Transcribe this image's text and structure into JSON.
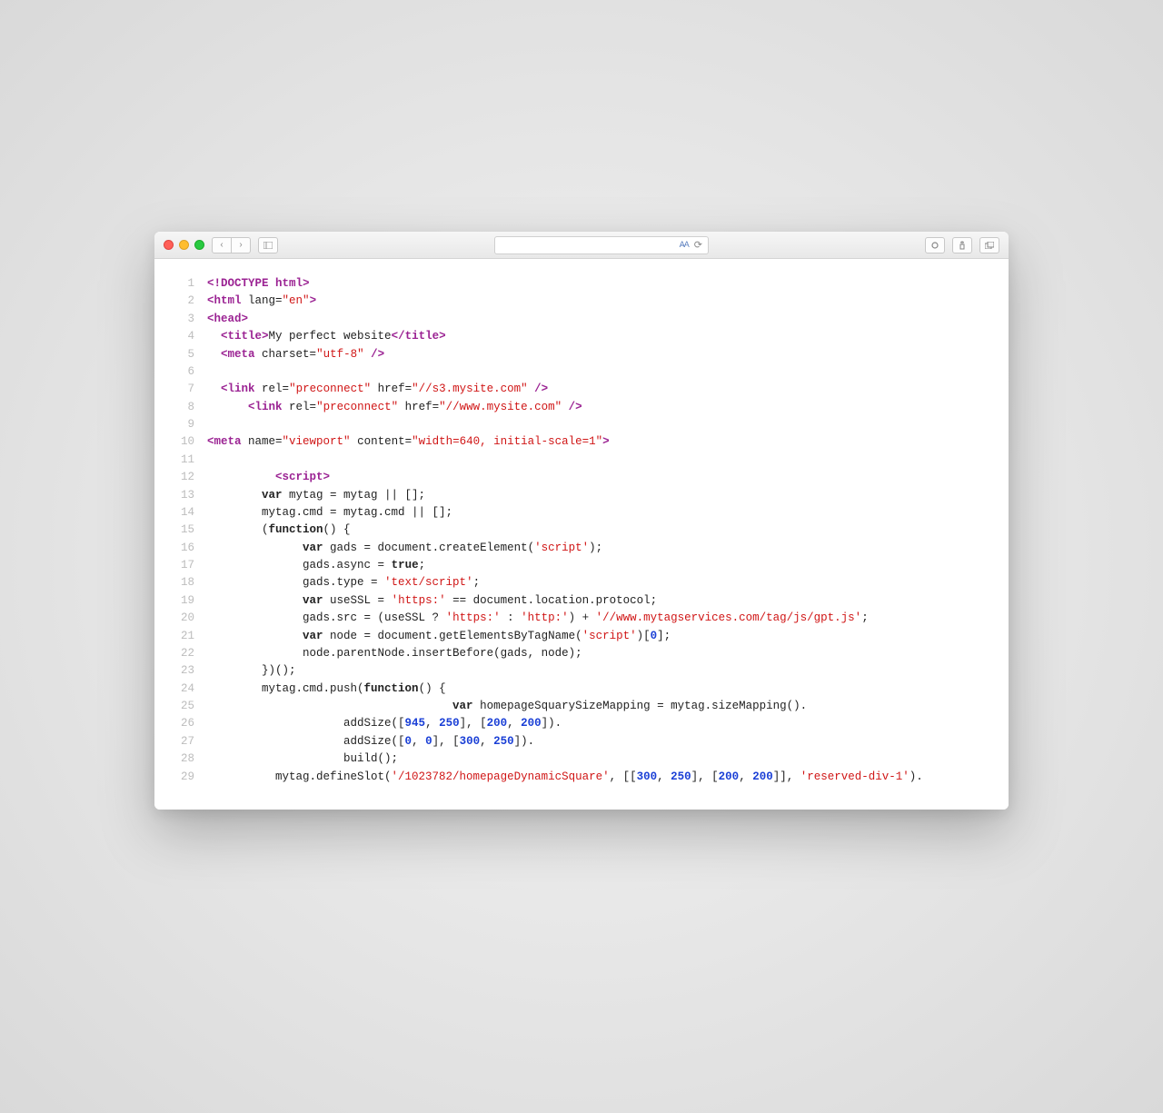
{
  "toolbar": {
    "addr_hint": "⟳",
    "reader_icon": "≡"
  },
  "code_lines": [
    {
      "n": 1,
      "indent": 0,
      "tokens": [
        [
          "tag",
          "<!DOCTYPE html>"
        ]
      ]
    },
    {
      "n": 2,
      "indent": 0,
      "tokens": [
        [
          "tag",
          "<html"
        ],
        [
          "plain",
          " "
        ],
        [
          "attr-name",
          "lang="
        ],
        [
          "str",
          "\"en\""
        ],
        [
          "tag",
          ">"
        ]
      ]
    },
    {
      "n": 3,
      "indent": 0,
      "tokens": [
        [
          "tag",
          "<head>"
        ]
      ]
    },
    {
      "n": 4,
      "indent": 2,
      "tokens": [
        [
          "tag",
          "<title>"
        ],
        [
          "plain",
          "My perfect website"
        ],
        [
          "tag",
          "</title>"
        ]
      ]
    },
    {
      "n": 5,
      "indent": 2,
      "tokens": [
        [
          "tag",
          "<meta"
        ],
        [
          "plain",
          " "
        ],
        [
          "attr-name",
          "charset="
        ],
        [
          "str",
          "\"utf-8\""
        ],
        [
          "plain",
          " "
        ],
        [
          "tag",
          "/>"
        ]
      ]
    },
    {
      "n": 6,
      "indent": 0,
      "tokens": []
    },
    {
      "n": 7,
      "indent": 2,
      "tokens": [
        [
          "tag",
          "<link"
        ],
        [
          "plain",
          " "
        ],
        [
          "attr-name",
          "rel="
        ],
        [
          "str",
          "\"preconnect\""
        ],
        [
          "plain",
          " "
        ],
        [
          "attr-name",
          "href="
        ],
        [
          "str",
          "\"//s3.mysite.com\""
        ],
        [
          "plain",
          " "
        ],
        [
          "tag",
          "/>"
        ]
      ]
    },
    {
      "n": 8,
      "indent": 6,
      "tokens": [
        [
          "tag",
          "<link"
        ],
        [
          "plain",
          " "
        ],
        [
          "attr-name",
          "rel="
        ],
        [
          "str",
          "\"preconnect\""
        ],
        [
          "plain",
          " "
        ],
        [
          "attr-name",
          "href="
        ],
        [
          "str",
          "\"//www.mysite.com\""
        ],
        [
          "plain",
          " "
        ],
        [
          "tag",
          "/>"
        ]
      ]
    },
    {
      "n": 9,
      "indent": 0,
      "tokens": []
    },
    {
      "n": 10,
      "indent": 0,
      "tokens": [
        [
          "tag",
          "<meta"
        ],
        [
          "plain",
          " "
        ],
        [
          "attr-name",
          "name="
        ],
        [
          "str",
          "\"viewport\""
        ],
        [
          "plain",
          " "
        ],
        [
          "attr-name",
          "content="
        ],
        [
          "str",
          "\"width=640, initial-scale=1\""
        ],
        [
          "tag",
          ">"
        ]
      ]
    },
    {
      "n": 11,
      "indent": 0,
      "tokens": []
    },
    {
      "n": 12,
      "indent": 10,
      "tokens": [
        [
          "tag",
          "<script>"
        ]
      ]
    },
    {
      "n": 13,
      "indent": 8,
      "tokens": [
        [
          "kw",
          "var"
        ],
        [
          "plain",
          " mytag = mytag || [];"
        ]
      ]
    },
    {
      "n": 14,
      "indent": 8,
      "tokens": [
        [
          "plain",
          "mytag.cmd = mytag.cmd || [];"
        ]
      ]
    },
    {
      "n": 15,
      "indent": 8,
      "tokens": [
        [
          "plain",
          "("
        ],
        [
          "kw",
          "function"
        ],
        [
          "plain",
          "() {"
        ]
      ]
    },
    {
      "n": 16,
      "indent": 14,
      "tokens": [
        [
          "kw",
          "var"
        ],
        [
          "plain",
          " gads = document.createElement("
        ],
        [
          "str",
          "'script'"
        ],
        [
          "plain",
          ");"
        ]
      ]
    },
    {
      "n": 17,
      "indent": 14,
      "tokens": [
        [
          "plain",
          "gads.async = "
        ],
        [
          "kw",
          "true"
        ],
        [
          "plain",
          ";"
        ]
      ]
    },
    {
      "n": 18,
      "indent": 14,
      "tokens": [
        [
          "plain",
          "gads.type = "
        ],
        [
          "str",
          "'text/script'"
        ],
        [
          "plain",
          ";"
        ]
      ]
    },
    {
      "n": 19,
      "indent": 14,
      "tokens": [
        [
          "kw",
          "var"
        ],
        [
          "plain",
          " useSSL = "
        ],
        [
          "str",
          "'https:'"
        ],
        [
          "plain",
          " == document.location.protocol;"
        ]
      ]
    },
    {
      "n": 20,
      "indent": 14,
      "tokens": [
        [
          "plain",
          "gads.src = (useSSL ? "
        ],
        [
          "str",
          "'https:'"
        ],
        [
          "plain",
          " : "
        ],
        [
          "str",
          "'http:'"
        ],
        [
          "plain",
          ") + "
        ],
        [
          "str",
          "'//www.mytagservices.com/tag/js/gpt.js'"
        ],
        [
          "plain",
          ";"
        ]
      ]
    },
    {
      "n": 21,
      "indent": 14,
      "tokens": [
        [
          "kw",
          "var"
        ],
        [
          "plain",
          " node = document.getElementsByTagName("
        ],
        [
          "str",
          "'script'"
        ],
        [
          "plain",
          ")["
        ],
        [
          "num",
          "0"
        ],
        [
          "plain",
          "];"
        ]
      ]
    },
    {
      "n": 22,
      "indent": 14,
      "tokens": [
        [
          "plain",
          "node.parentNode.insertBefore(gads, node);"
        ]
      ]
    },
    {
      "n": 23,
      "indent": 8,
      "tokens": [
        [
          "plain",
          "})();"
        ]
      ]
    },
    {
      "n": 24,
      "indent": 8,
      "tokens": [
        [
          "plain",
          "mytag.cmd.push("
        ],
        [
          "kw",
          "function"
        ],
        [
          "plain",
          "() {"
        ]
      ]
    },
    {
      "n": 25,
      "indent": 36,
      "tokens": [
        [
          "kw",
          "var"
        ],
        [
          "plain",
          " homepageSquarySizeMapping = mytag.sizeMapping()."
        ]
      ]
    },
    {
      "n": 26,
      "indent": 20,
      "tokens": [
        [
          "plain",
          "addSize(["
        ],
        [
          "num",
          "945"
        ],
        [
          "plain",
          ", "
        ],
        [
          "num",
          "250"
        ],
        [
          "plain",
          "], ["
        ],
        [
          "num",
          "200"
        ],
        [
          "plain",
          ", "
        ],
        [
          "num",
          "200"
        ],
        [
          "plain",
          "])."
        ]
      ]
    },
    {
      "n": 27,
      "indent": 20,
      "tokens": [
        [
          "plain",
          "addSize(["
        ],
        [
          "num",
          "0"
        ],
        [
          "plain",
          ", "
        ],
        [
          "num",
          "0"
        ],
        [
          "plain",
          "], ["
        ],
        [
          "num",
          "300"
        ],
        [
          "plain",
          ", "
        ],
        [
          "num",
          "250"
        ],
        [
          "plain",
          "])."
        ]
      ]
    },
    {
      "n": 28,
      "indent": 20,
      "tokens": [
        [
          "plain",
          "build();"
        ]
      ]
    },
    {
      "n": 29,
      "indent": 10,
      "tokens": [
        [
          "plain",
          "mytag.defineSlot("
        ],
        [
          "str",
          "'/1023782/homepageDynamicSquare'"
        ],
        [
          "plain",
          ", [["
        ],
        [
          "num",
          "300"
        ],
        [
          "plain",
          ", "
        ],
        [
          "num",
          "250"
        ],
        [
          "plain",
          "], ["
        ],
        [
          "num",
          "200"
        ],
        [
          "plain",
          ", "
        ],
        [
          "num",
          "200"
        ],
        [
          "plain",
          "]], "
        ],
        [
          "str",
          "'reserved-div-1'"
        ],
        [
          "plain",
          ")."
        ]
      ]
    }
  ]
}
